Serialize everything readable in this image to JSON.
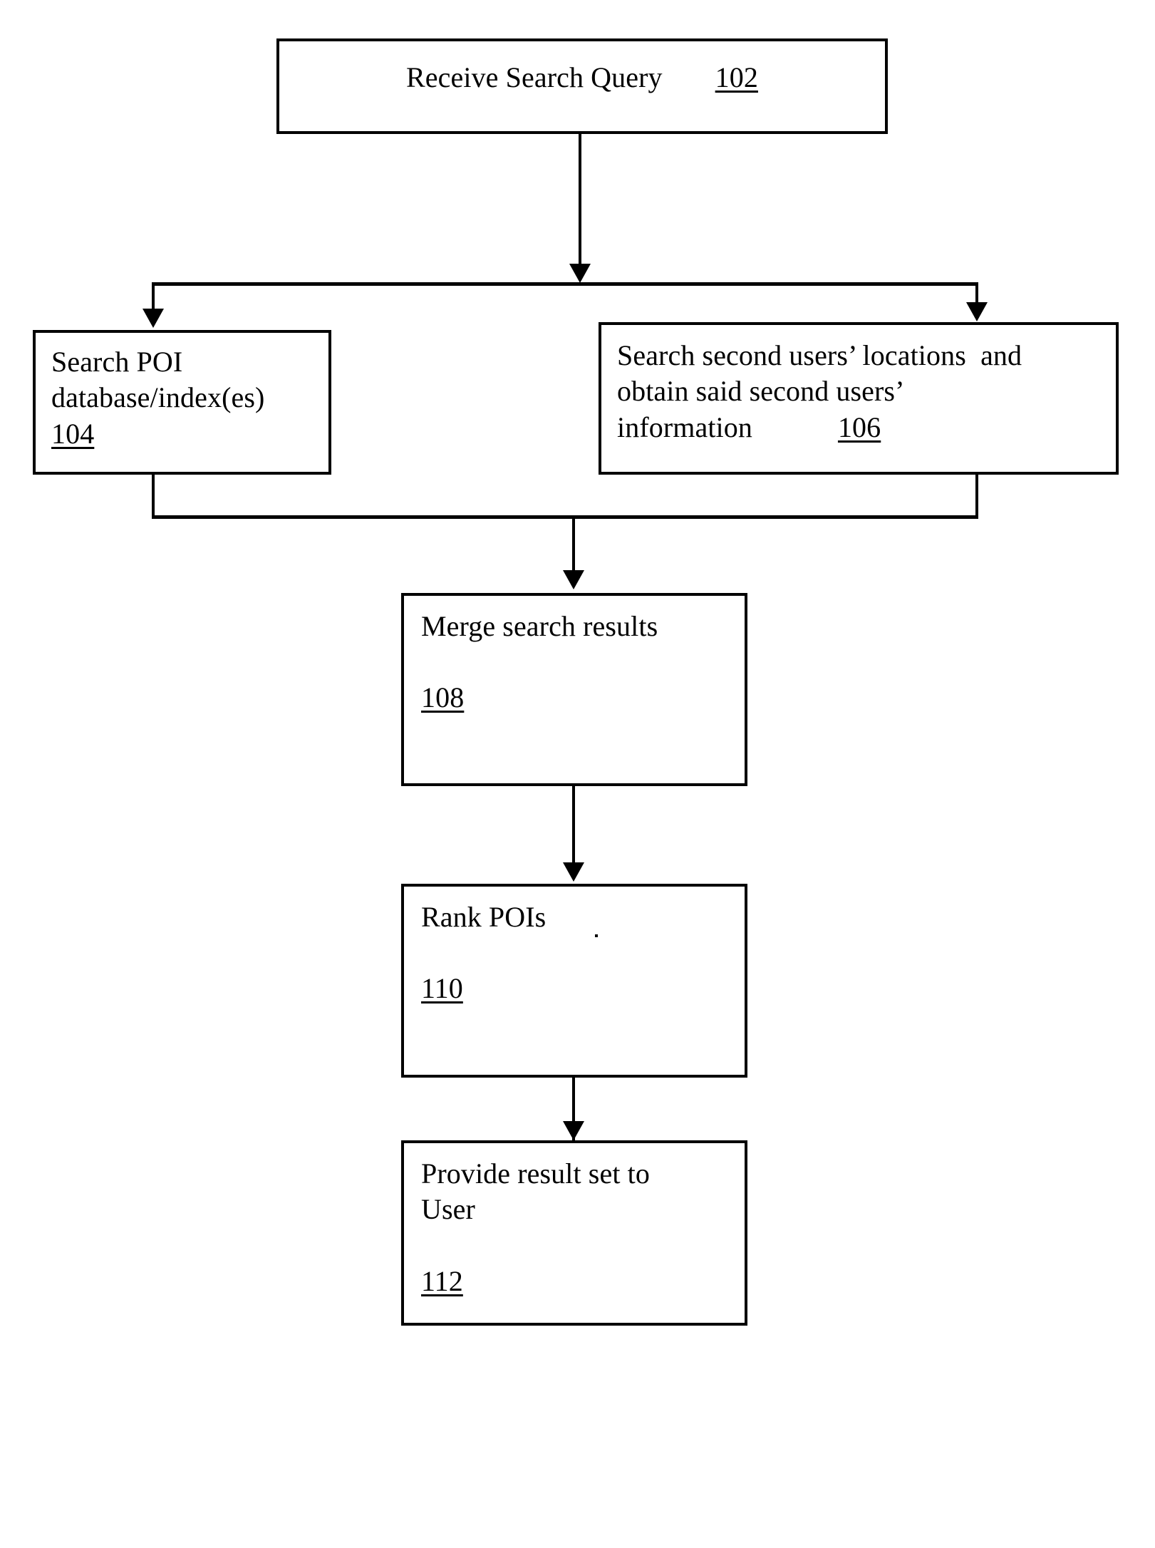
{
  "figure": {
    "type": "flowchart",
    "orientation": "top-to-bottom",
    "background_color": "#ffffff",
    "stroke_color": "#000000"
  },
  "nodes": [
    {
      "id": "102",
      "ref": "102",
      "label": "Receive Search Query",
      "lines": [
        "Receive Search Query"
      ]
    },
    {
      "id": "104",
      "ref": "104",
      "label": "Search POI database/index(es)",
      "lines": [
        "Search POI",
        "database/index(es)"
      ]
    },
    {
      "id": "106",
      "ref": "106",
      "label": "Search second users’ locations and obtain said second users’ information",
      "lines": [
        "Search second users’ locations  and",
        "obtain said second users’",
        "information"
      ]
    },
    {
      "id": "108",
      "ref": "108",
      "label": "Merge search results",
      "lines": [
        "Merge search results"
      ]
    },
    {
      "id": "110",
      "ref": "110",
      "label": "Rank POIs",
      "lines": [
        "Rank POIs"
      ]
    },
    {
      "id": "112",
      "ref": "112",
      "label": "Provide result set to User",
      "lines": [
        "Provide result set to",
        "User"
      ]
    }
  ],
  "edges": [
    {
      "from": "102",
      "to": "104",
      "style": "split-branch"
    },
    {
      "from": "102",
      "to": "106",
      "style": "split-branch"
    },
    {
      "from": "104",
      "to": "108",
      "style": "merge-branch"
    },
    {
      "from": "106",
      "to": "108",
      "style": "merge-branch"
    },
    {
      "from": "108",
      "to": "110",
      "style": "straight"
    },
    {
      "from": "110",
      "to": "112",
      "style": "straight"
    }
  ]
}
